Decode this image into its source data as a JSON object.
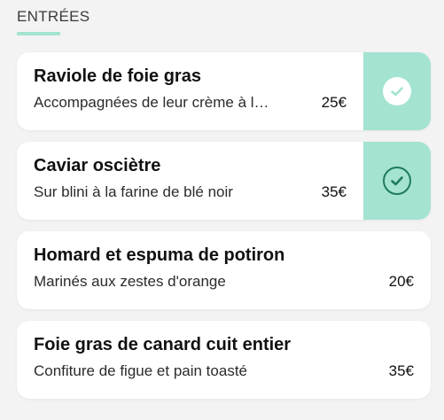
{
  "section": {
    "title": "ENTRÉES"
  },
  "items": [
    {
      "name": "Raviole de foie gras",
      "description": "Accompagnées de leur crème à l…",
      "price": "25€",
      "selected": true,
      "check_style": "filled"
    },
    {
      "name": "Caviar osciètre",
      "description": "Sur blini à la farine de blé noir",
      "price": "35€",
      "selected": true,
      "check_style": "outlined"
    },
    {
      "name": "Homard et espuma de potiron",
      "description": "Marinés aux zestes d'orange",
      "price": "20€",
      "selected": false
    },
    {
      "name": "Foie gras de canard cuit entier",
      "description": "Confiture de figue et pain toasté",
      "price": "35€",
      "selected": false
    }
  ],
  "colors": {
    "accent": "#a4e3d1",
    "check_dark": "#1e7a5f",
    "background": "#f3f3f3",
    "card": "#ffffff"
  },
  "icons": {
    "check": "check-icon"
  }
}
